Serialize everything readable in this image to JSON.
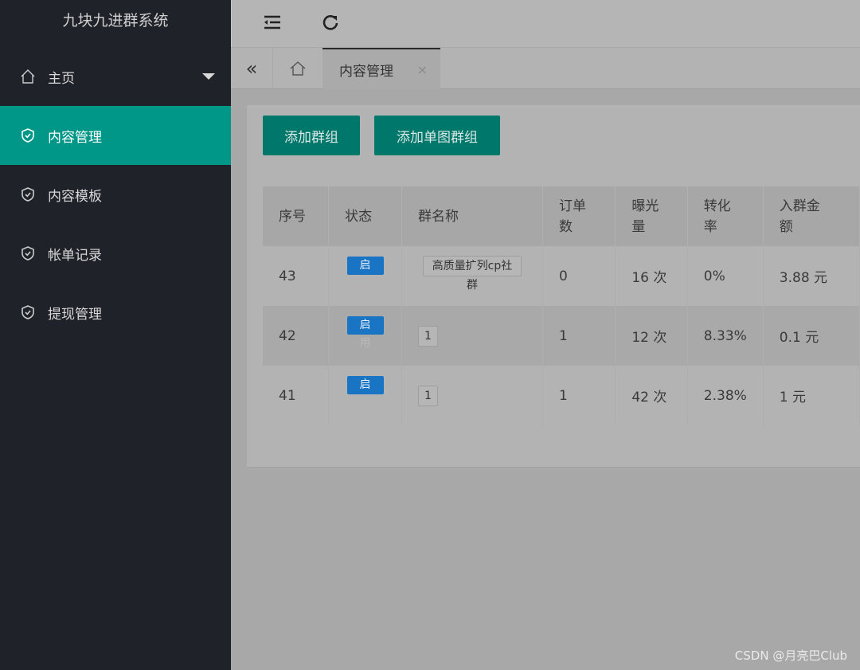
{
  "app_title": "九块九进群系统",
  "sidebar": {
    "items": [
      {
        "label": "主页",
        "icon": "home-icon"
      },
      {
        "label": "内容管理",
        "icon": "shield-check-icon",
        "active": true
      },
      {
        "label": "内容模板",
        "icon": "shield-check-icon"
      },
      {
        "label": "帐单记录",
        "icon": "shield-check-icon"
      },
      {
        "label": "提现管理",
        "icon": "shield-check-icon"
      }
    ]
  },
  "tabs": {
    "active": "内容管理",
    "close": "×"
  },
  "toolbar": {
    "add_group": "添加群组",
    "add_single_group": "添加单图群组"
  },
  "table": {
    "headers": [
      "序号",
      "状态",
      "群名称",
      "订单\n数",
      "曝光\n量",
      "转化\n率",
      "入群金\n额"
    ],
    "rows": [
      {
        "id": "43",
        "status": "启",
        "status_sub": "",
        "name": "高质量扩列cp社",
        "name_wrap": "群",
        "orders": "0",
        "views": "16 次",
        "rate": "0%",
        "amount": "3.88 元"
      },
      {
        "id": "42",
        "status": "启",
        "status_sub": "用",
        "name": "1",
        "name_wrap": "",
        "orders": "1",
        "views": "12 次",
        "rate": "8.33%",
        "amount": "0.1 元"
      },
      {
        "id": "41",
        "status": "启",
        "status_sub": "",
        "name": "1",
        "name_wrap": "",
        "orders": "1",
        "views": "42 次",
        "rate": "2.38%",
        "amount": "1 元"
      }
    ]
  },
  "watermark": "CSDN @月亮巴Club",
  "colors": {
    "sidebar": "#1f2229",
    "accent": "#009688",
    "badge": "#1a74c4"
  }
}
